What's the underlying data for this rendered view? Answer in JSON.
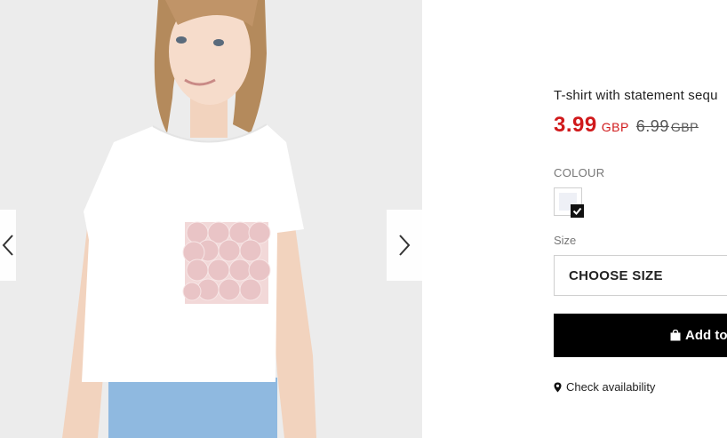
{
  "gallery": {
    "image_alt": "Girl wearing white T-shirt with sequin pocket",
    "prev_icon": "chevron-left-icon",
    "next_icon": "chevron-right-icon"
  },
  "product": {
    "title": "T-shirt with statement sequ",
    "sale_price": "3.99",
    "sale_currency": "GBP",
    "old_price": "6.99",
    "old_currency": "GBP"
  },
  "colour": {
    "label": "COLOUR",
    "swatch_color": "#eef0f6",
    "selected": true
  },
  "size": {
    "label": "Size",
    "placeholder": "CHOOSE SIZE"
  },
  "cart": {
    "button_label": "Add to",
    "icon": "shopping-bag-icon"
  },
  "availability": {
    "label": "Check availability",
    "icon": "map-pin-icon"
  },
  "colors": {
    "sale": "#d0191b",
    "button_bg": "#000000"
  }
}
